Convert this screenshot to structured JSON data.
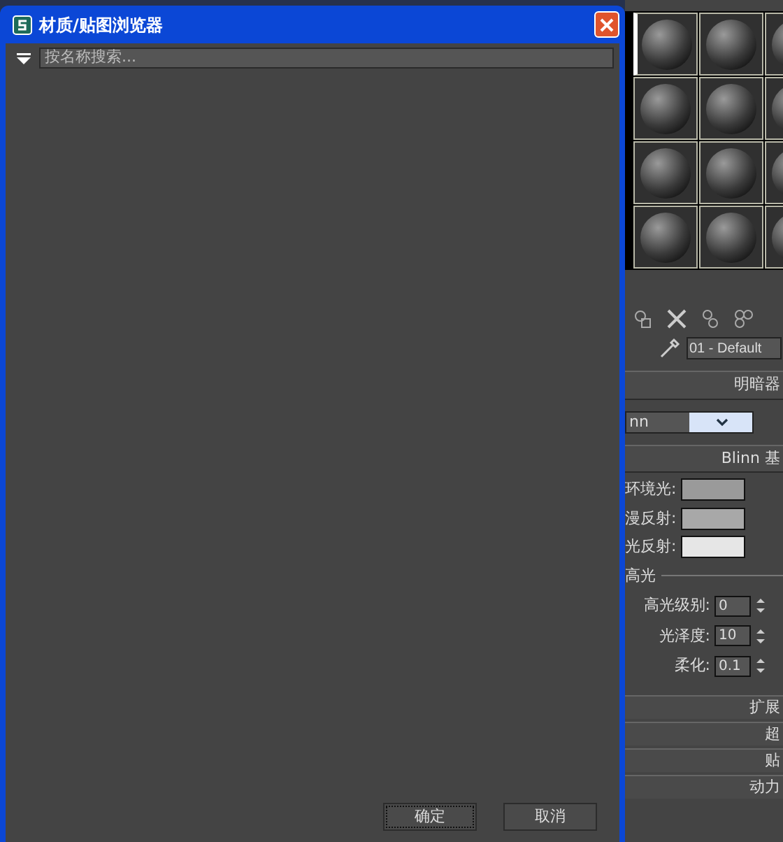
{
  "dialog": {
    "title": "材质/贴图浏览器",
    "search": {
      "placeholder": "按名称搜索..."
    },
    "buttons": [
      {
        "label": "确定",
        "selected": true
      },
      {
        "label": "取消",
        "selected": false
      }
    ]
  },
  "side_panel": {
    "slots": [
      {
        "selected": true
      },
      {
        "selected": false
      },
      {
        "selected": false
      },
      {
        "selected": false
      },
      {
        "selected": false
      },
      {
        "selected": false
      },
      {
        "selected": false
      },
      {
        "selected": false
      },
      {
        "selected": false
      },
      {
        "selected": false
      },
      {
        "selected": false
      },
      {
        "selected": false
      }
    ],
    "material_name": "01 - Default",
    "shader_rollout": {
      "title": "明暗器",
      "shader": "nn"
    },
    "basic_rollout": {
      "title": "Blinn 基",
      "colors": [
        {
          "label": "环境光:",
          "color": "#9a9a9a"
        },
        {
          "label": "漫反射:",
          "color": "#a8a8a8"
        },
        {
          "label": "光反射:",
          "color": "#e6e6e6"
        }
      ],
      "group": "高光",
      "spinners": [
        {
          "label": "高光级别:",
          "value": "0"
        },
        {
          "label": "光泽度:",
          "value": "10"
        },
        {
          "label": "柔化:",
          "value": "0.1"
        }
      ]
    },
    "collapsed_rollouts": [
      "扩展",
      "超",
      "贴",
      "动力"
    ]
  }
}
